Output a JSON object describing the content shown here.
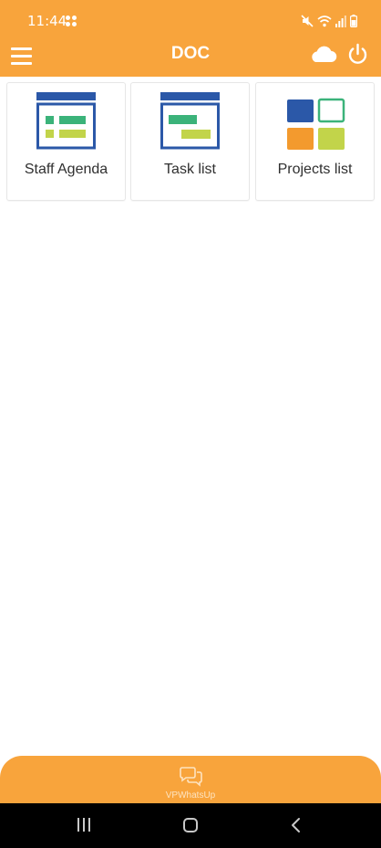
{
  "status_bar": {
    "time": "11:44"
  },
  "app_bar": {
    "title": "DOC",
    "menu_icon": "hamburger-menu-icon",
    "cloud_icon": "cloud-icon",
    "power_icon": "power-icon"
  },
  "tiles": [
    {
      "label": "Staff Agenda",
      "icon": "staff-agenda-icon"
    },
    {
      "label": "Task list",
      "icon": "task-list-icon"
    },
    {
      "label": "Projects list",
      "icon": "projects-grid-icon"
    }
  ],
  "bottom_bar": {
    "label": "VPWhatsUp",
    "icon": "chat-bubbles-icon"
  },
  "colors": {
    "accent": "#f8a43c",
    "icon_blue": "#2b58a8",
    "icon_green": "#3bb37a",
    "icon_lime": "#c2d44a",
    "icon_orange": "#f39a2e"
  }
}
